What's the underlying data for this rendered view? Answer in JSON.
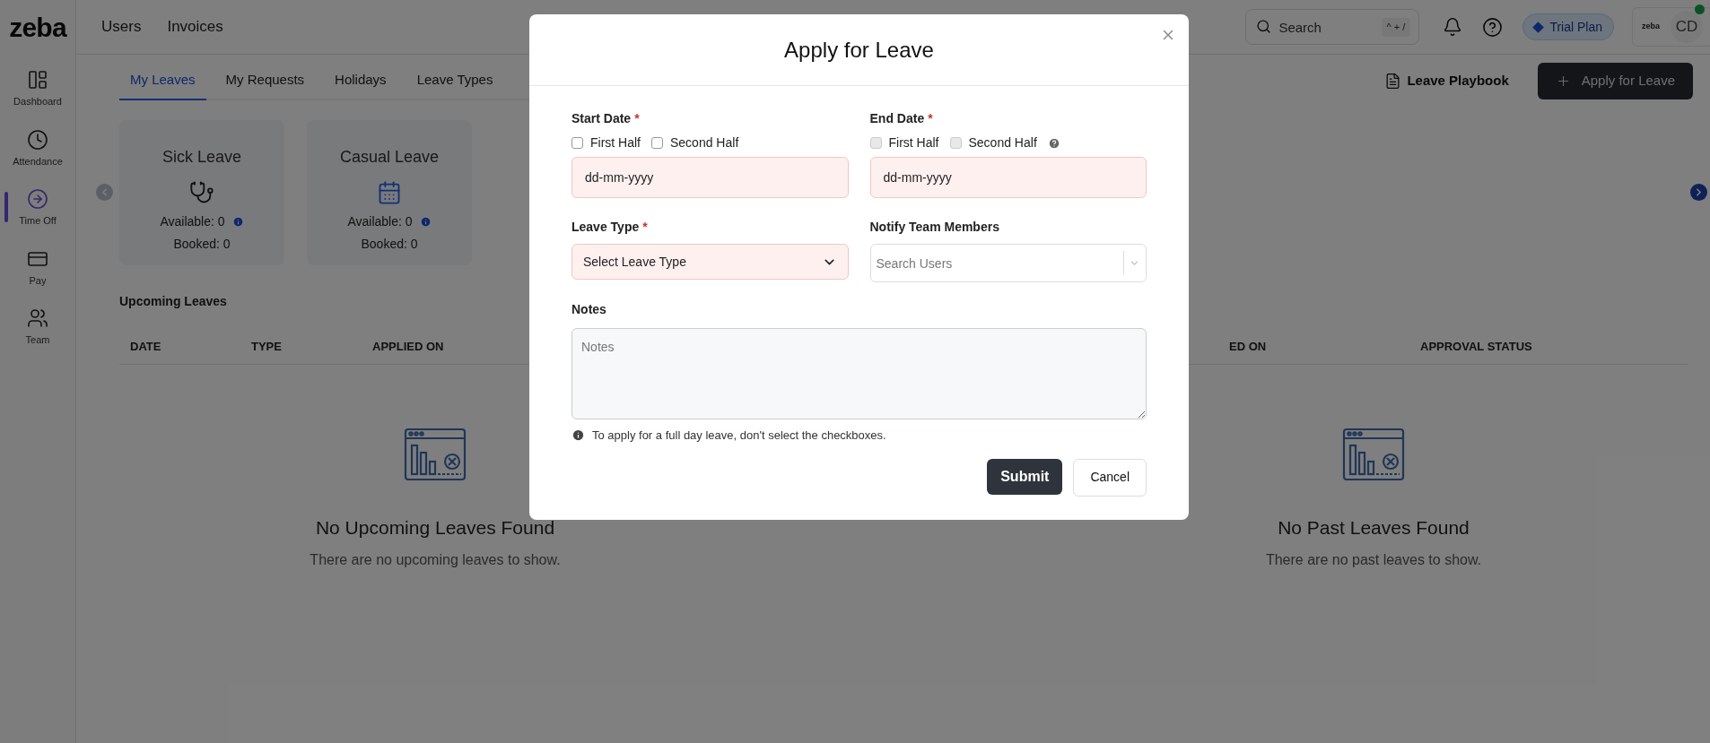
{
  "topbar": {
    "logo": "zeba",
    "nav": [
      {
        "label": "Users"
      },
      {
        "label": "Invoices"
      }
    ],
    "search": {
      "placeholder": "Search",
      "shortcut": "^ + /"
    },
    "plan_badge": "Trial Plan",
    "account": {
      "logo_text": "zeba",
      "initials": "CD",
      "online": true
    }
  },
  "sidebar": {
    "items": [
      {
        "label": "Dashboard",
        "selected": false
      },
      {
        "label": "Attendance",
        "selected": false
      },
      {
        "label": "Time Off",
        "selected": true
      },
      {
        "label": "Pay",
        "selected": false
      },
      {
        "label": "Team",
        "selected": false
      }
    ]
  },
  "tabs": [
    {
      "label": "My Leaves",
      "selected": true
    },
    {
      "label": "My Requests",
      "selected": false
    },
    {
      "label": "Holidays",
      "selected": false
    },
    {
      "label": "Leave Types",
      "selected": false
    }
  ],
  "actions": {
    "playbook": "Leave Playbook",
    "apply_button": "Apply for Leave"
  },
  "leave_cards": [
    {
      "title": "Sick Leave",
      "available": "Available: 0",
      "booked": "Booked: 0"
    },
    {
      "title": "Casual Leave",
      "available": "Available: 0",
      "booked": "Booked: 0"
    }
  ],
  "upcoming": {
    "title": "Upcoming Leaves",
    "columns": [
      "DATE",
      "TYPE",
      "APPLIED ON"
    ],
    "empty_title": "No Upcoming Leaves Found",
    "empty_text": "There are no upcoming leaves to show."
  },
  "past": {
    "columns": [
      "ED ON",
      "APPROVAL STATUS"
    ],
    "empty_title": "No Past Leaves Found",
    "empty_text": "There are no past leaves to show."
  },
  "modal": {
    "title": "Apply for Leave",
    "dates": [
      {
        "label": "Start Date",
        "required_mark": "*",
        "checkboxes": [
          {
            "label": "First Half",
            "checked": false,
            "disabled": false
          },
          {
            "label": "Second Half",
            "checked": false,
            "disabled": false
          }
        ],
        "placeholder": "dd-mm-yyyy",
        "invalid": true
      },
      {
        "label": "End Date",
        "required_mark": "*",
        "checkboxes": [
          {
            "label": "First Half",
            "checked": false,
            "disabled": true
          },
          {
            "label": "Second Half",
            "checked": false,
            "disabled": true
          }
        ],
        "help": true,
        "placeholder": "dd-mm-yyyy",
        "invalid": true
      }
    ],
    "leave_type": {
      "label": "Leave Type",
      "required_mark": "*",
      "placeholder": "Select Leave Type",
      "invalid": true
    },
    "notify": {
      "label": "Notify Team Members",
      "placeholder": "Search Users"
    },
    "notes": {
      "label": "Notes",
      "placeholder": "Notes"
    },
    "hint": "To apply for a full day leave, don't select the checkboxes.",
    "buttons": [
      {
        "label": "Submit",
        "kind": "primary"
      },
      {
        "label": "Cancel",
        "kind": "secondary"
      }
    ]
  }
}
